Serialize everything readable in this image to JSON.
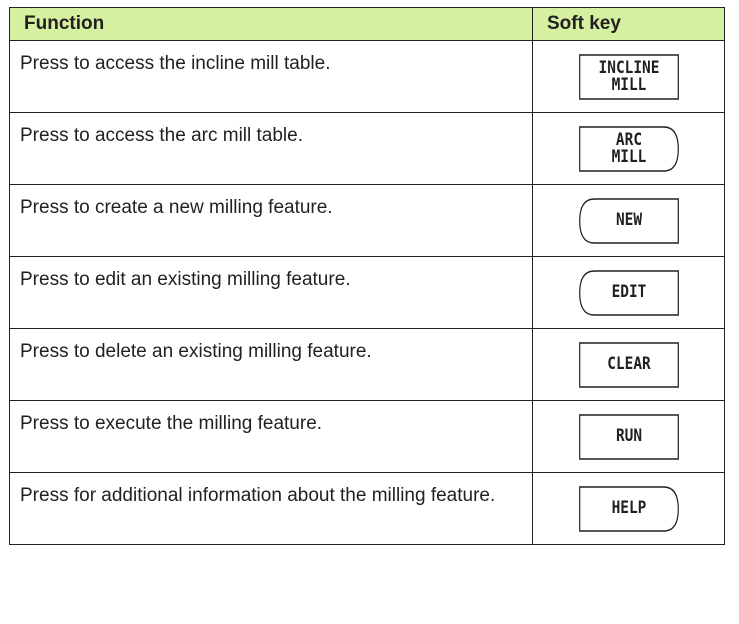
{
  "table": {
    "headers": {
      "function": "Function",
      "soft_key": "Soft key"
    },
    "rows": [
      {
        "description": "Press to access the incline mill table.",
        "softkey_label": "INCLINE\nMILL",
        "softkey_shape": "rectangle"
      },
      {
        "description": "Press to access the arc mill table.",
        "softkey_label": "ARC\nMILL",
        "softkey_shape": "right-rounded"
      },
      {
        "description": "Press to create a new milling feature.",
        "softkey_label": "NEW",
        "softkey_shape": "left-rounded"
      },
      {
        "description": "Press to edit an existing milling feature.",
        "softkey_label": "EDIT",
        "softkey_shape": "left-rounded"
      },
      {
        "description": "Press to delete an existing milling feature.",
        "softkey_label": "CLEAR",
        "softkey_shape": "rectangle"
      },
      {
        "description": "Press to execute the milling feature.",
        "softkey_label": "RUN",
        "softkey_shape": "rectangle"
      },
      {
        "description": "Press for additional information about the milling feature.",
        "softkey_label": "HELP",
        "softkey_shape": "right-rounded"
      }
    ]
  },
  "colors": {
    "header_background": "#d4f0a0",
    "text": "#231f20",
    "border": "#231f20"
  }
}
